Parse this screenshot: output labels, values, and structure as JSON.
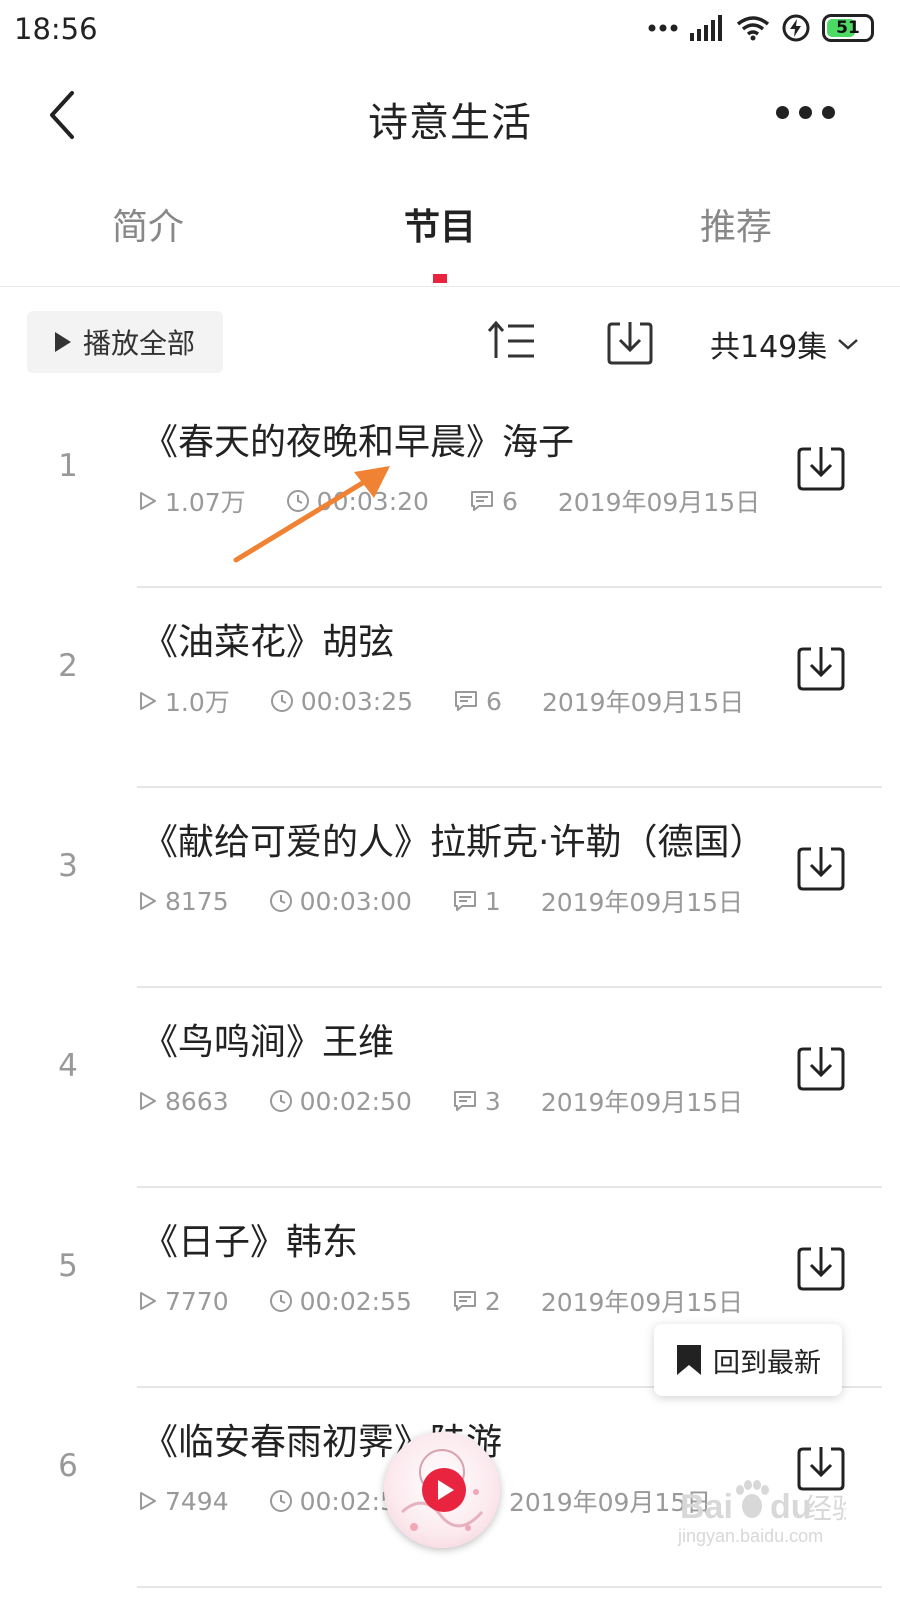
{
  "status": {
    "time": "18:56",
    "battery": "51"
  },
  "header": {
    "title": "诗意生活"
  },
  "tabs": [
    {
      "label": "简介"
    },
    {
      "label": "节目"
    },
    {
      "label": "推荐"
    }
  ],
  "toolbar": {
    "play_all": "播放全部",
    "total": "共149集"
  },
  "episodes": [
    {
      "index": "1",
      "title": "《春天的夜晚和早晨》海子",
      "plays": "1.07万",
      "duration": "00:03:20",
      "comments": "6",
      "date": "2019年09月15日"
    },
    {
      "index": "2",
      "title": "《油菜花》胡弦",
      "plays": "1.0万",
      "duration": "00:03:25",
      "comments": "6",
      "date": "2019年09月15日"
    },
    {
      "index": "3",
      "title": "《献给可爱的人》拉斯克·许勒（德国）",
      "plays": "8175",
      "duration": "00:03:00",
      "comments": "1",
      "date": "2019年09月15日"
    },
    {
      "index": "4",
      "title": "《鸟鸣涧》王维",
      "plays": "8663",
      "duration": "00:02:50",
      "comments": "3",
      "date": "2019年09月15日"
    },
    {
      "index": "5",
      "title": "《日子》韩东",
      "plays": "7770",
      "duration": "00:02:55",
      "comments": "2",
      "date": "2019年09月15日"
    },
    {
      "index": "6",
      "title": "《临安春雨初霁》陆游",
      "plays": "7494",
      "duration": "00:02:5",
      "comments": "",
      "date": "2019年09月15日"
    }
  ],
  "floating": {
    "back_to_latest": "回到最新"
  },
  "watermark": {
    "brand": "Bai du 经验",
    "url": "jingyan.baidu.com"
  },
  "colors": {
    "accent": "#e8243f",
    "annotation_arrow": "#f08233"
  }
}
